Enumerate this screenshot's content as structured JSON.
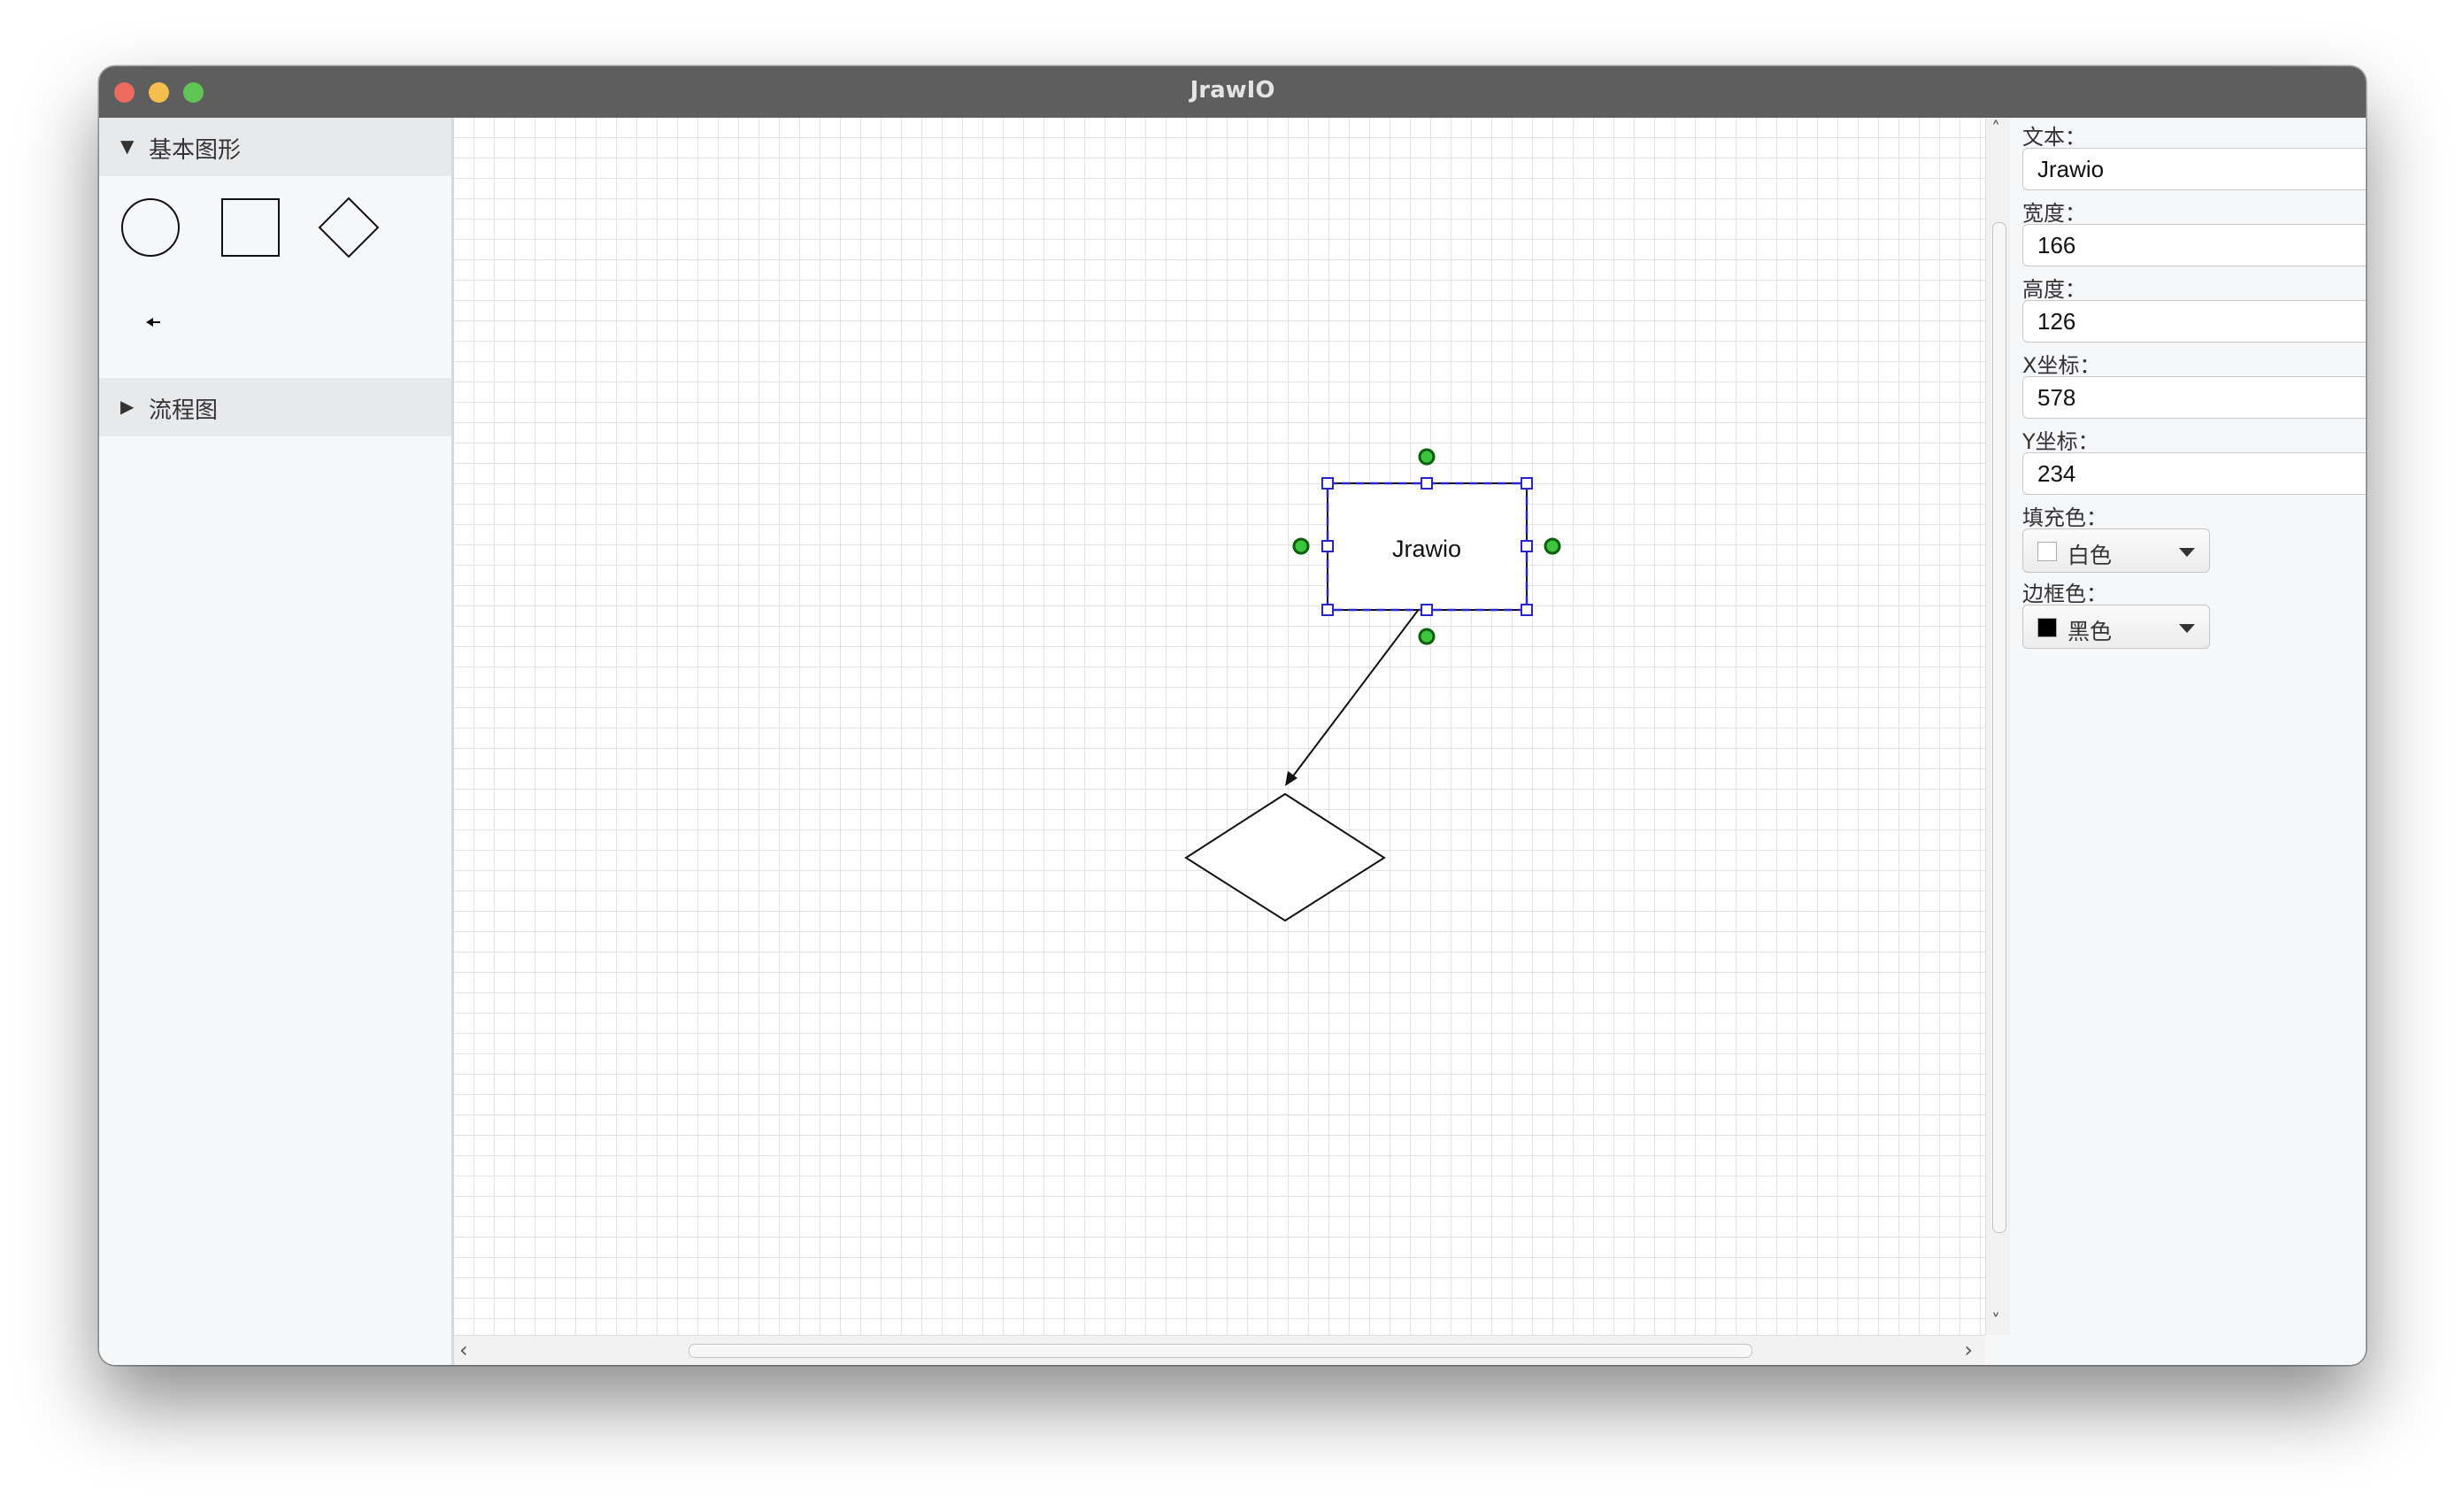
{
  "window": {
    "title": "JrawIO"
  },
  "palette": {
    "sections": [
      {
        "label": "基本图形",
        "expanded": true,
        "arrow": "▼",
        "shapes": [
          "circle-icon",
          "rectangle-icon",
          "diamond-icon",
          "arrow-left-icon"
        ]
      },
      {
        "label": "流程图",
        "expanded": false,
        "arrow": "▶"
      }
    ]
  },
  "canvas": {
    "grid": true,
    "selected_shape": {
      "type": "rectangle",
      "text": "Jrawio",
      "selection_color": "#2222cc",
      "anchor_color": "#1aa11a"
    },
    "other_shapes": [
      {
        "type": "diamond"
      }
    ],
    "connector": {
      "type": "arrow",
      "from": "rectangle",
      "to": "diamond"
    }
  },
  "properties": {
    "text_label": "文本：",
    "text_value": "Jrawio",
    "width_label": "宽度：",
    "width_value": "166",
    "height_label": "高度：",
    "height_value": "126",
    "x_label": "X坐标：",
    "x_value": "578",
    "y_label": "Y坐标：",
    "y_value": "234",
    "fill_label": "填充色：",
    "fill_value": "白色",
    "fill_color": "#ffffff",
    "border_label": "边框色：",
    "border_value": "黑色",
    "border_color": "#000000"
  },
  "scrollbars": {
    "up": "˄",
    "down": "˅",
    "left": "‹",
    "right": "›"
  }
}
